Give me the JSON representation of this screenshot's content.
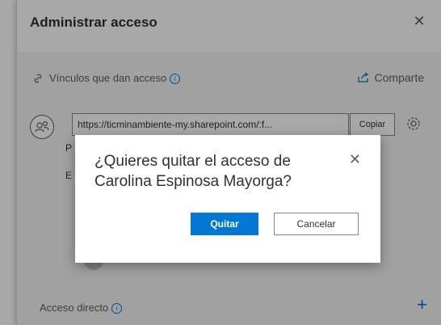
{
  "panel": {
    "title": "Administrar acceso",
    "close_icon": "close-icon",
    "links_section": {
      "label": "Vínculos que dan acceso",
      "info_icon": "info-icon",
      "share_label": "Comparte"
    },
    "link": {
      "url": "https://ticminambiente-my.sharepoint.com/:f...",
      "copy_label": "Copiar"
    },
    "ghost_letters": {
      "p": "P",
      "e": "E"
    },
    "direct_access_label": "Acceso directo",
    "add_icon": "+"
  },
  "dialog": {
    "title": "¿Quieres quitar el acceso de Carolina Espinosa Mayorga?",
    "confirm_label": "Quitar",
    "cancel_label": "Cancelar"
  },
  "colors": {
    "accent": "#0078d4",
    "overlay": "rgba(0,0,0,0.34)",
    "text": "#323130"
  }
}
